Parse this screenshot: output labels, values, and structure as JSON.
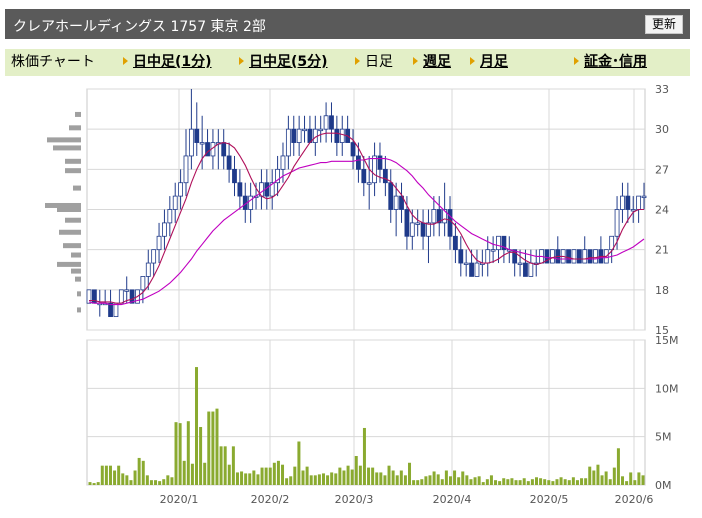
{
  "header": {
    "title": "クレアホールディングス  1757  東京 2部",
    "refresh_label": "更新"
  },
  "nav": {
    "label": "株価チャート",
    "items": [
      {
        "label": "日中足(1分)",
        "link": true
      },
      {
        "label": "日中足(5分)",
        "link": true
      },
      {
        "label": "日足",
        "link": false
      },
      {
        "label": "週足",
        "link": true
      },
      {
        "label": "月足",
        "link": true
      },
      {
        "label": "証金･信用",
        "link": true
      }
    ]
  },
  "chart_data": [
    {
      "type": "candlestick",
      "title": "",
      "ylim": [
        15,
        33
      ],
      "yticks": [
        "15",
        "18",
        "21",
        "24",
        "27",
        "30",
        "33"
      ],
      "xticks": [
        "2020/1",
        "2020/2",
        "2020/3",
        "2020/4",
        "2020/5",
        "2020/6"
      ],
      "grid": true,
      "colors": {
        "up": "#ffffff",
        "down": "#1f3a8a",
        "ma_short": "#b0105a",
        "ma_long": "#c000c0",
        "volume_profile": "#a0a0a0",
        "volume": "#8aaa30"
      },
      "candles": [
        [
          17,
          18,
          17,
          18
        ],
        [
          18,
          18,
          17,
          17
        ],
        [
          17,
          18,
          16,
          17
        ],
        [
          17,
          18,
          17,
          17
        ],
        [
          17,
          18,
          16,
          16
        ],
        [
          16,
          17,
          16,
          17
        ],
        [
          17,
          18,
          17,
          18
        ],
        [
          18,
          19,
          17,
          18
        ],
        [
          18,
          18,
          17,
          17
        ],
        [
          17,
          18,
          17,
          18
        ],
        [
          18,
          19,
          17,
          19
        ],
        [
          19,
          21,
          18,
          20
        ],
        [
          20,
          21,
          19,
          21
        ],
        [
          21,
          23,
          20,
          22
        ],
        [
          22,
          24,
          21,
          23
        ],
        [
          23,
          25,
          22,
          24
        ],
        [
          24,
          26,
          23,
          25
        ],
        [
          25,
          27,
          24,
          26
        ],
        [
          26,
          30,
          25,
          28
        ],
        [
          28,
          33,
          27,
          30
        ],
        [
          30,
          32,
          28,
          29
        ],
        [
          29,
          31,
          27,
          29
        ],
        [
          29,
          30,
          28,
          28
        ],
        [
          28,
          30,
          27,
          29
        ],
        [
          29,
          30,
          27,
          29
        ],
        [
          29,
          30,
          27,
          28
        ],
        [
          28,
          29,
          26,
          27
        ],
        [
          27,
          28,
          25,
          26
        ],
        [
          26,
          27,
          24,
          25
        ],
        [
          25,
          26,
          23,
          24
        ],
        [
          24,
          26,
          23,
          25
        ],
        [
          25,
          26,
          24,
          25
        ],
        [
          25,
          27,
          24,
          26
        ],
        [
          26,
          27,
          24,
          25
        ],
        [
          25,
          27,
          24,
          26
        ],
        [
          26,
          28,
          25,
          27
        ],
        [
          27,
          29,
          26,
          28
        ],
        [
          28,
          31,
          27,
          30
        ],
        [
          30,
          31,
          28,
          29
        ],
        [
          29,
          31,
          28,
          30
        ],
        [
          30,
          31,
          29,
          30
        ],
        [
          30,
          31,
          29,
          29
        ],
        [
          29,
          31,
          28,
          30
        ],
        [
          30,
          31,
          29,
          30
        ],
        [
          30,
          32,
          29,
          31
        ],
        [
          31,
          32,
          29,
          30
        ],
        [
          30,
          31,
          28,
          29
        ],
        [
          29,
          31,
          28,
          30
        ],
        [
          30,
          31,
          29,
          29
        ],
        [
          29,
          30,
          27,
          28
        ],
        [
          28,
          29,
          26,
          27
        ],
        [
          27,
          28,
          25,
          26
        ],
        [
          26,
          28,
          24,
          26
        ],
        [
          26,
          29,
          25,
          28
        ],
        [
          28,
          29,
          26,
          27
        ],
        [
          27,
          28,
          25,
          26
        ],
        [
          26,
          27,
          23,
          24
        ],
        [
          24,
          26,
          22,
          25
        ],
        [
          25,
          26,
          23,
          24
        ],
        [
          24,
          25,
          21,
          22
        ],
        [
          22,
          24,
          21,
          23
        ],
        [
          23,
          24,
          22,
          23
        ],
        [
          23,
          24,
          21,
          22
        ],
        [
          22,
          24,
          20,
          23
        ],
        [
          23,
          25,
          22,
          24
        ],
        [
          24,
          25,
          22,
          23
        ],
        [
          23,
          26,
          22,
          24
        ],
        [
          24,
          25,
          21,
          22
        ],
        [
          22,
          23,
          20,
          21
        ],
        [
          21,
          22,
          19,
          20
        ],
        [
          20,
          21,
          19,
          20
        ],
        [
          20,
          21,
          19,
          19
        ],
        [
          19,
          21,
          19,
          20
        ],
        [
          20,
          21,
          19,
          20
        ],
        [
          20,
          22,
          19,
          21
        ],
        [
          21,
          22,
          20,
          21
        ],
        [
          21,
          22,
          20,
          22
        ],
        [
          22,
          22,
          20,
          21
        ],
        [
          21,
          22,
          20,
          21
        ],
        [
          21,
          21,
          19,
          20
        ],
        [
          20,
          21,
          19,
          20
        ],
        [
          20,
          21,
          19,
          19
        ],
        [
          19,
          21,
          19,
          20
        ],
        [
          20,
          21,
          19,
          20
        ],
        [
          20,
          21,
          20,
          21
        ],
        [
          21,
          21,
          20,
          20
        ],
        [
          20,
          21,
          20,
          21
        ],
        [
          21,
          22,
          20,
          20
        ],
        [
          20,
          21,
          20,
          21
        ],
        [
          21,
          21,
          20,
          20
        ],
        [
          20,
          21,
          20,
          21
        ],
        [
          21,
          21,
          20,
          20
        ],
        [
          20,
          22,
          20,
          21
        ],
        [
          21,
          21,
          20,
          20
        ],
        [
          20,
          21,
          20,
          21
        ],
        [
          21,
          22,
          20,
          20
        ],
        [
          20,
          21,
          20,
          21
        ],
        [
          21,
          22,
          20,
          22
        ],
        [
          22,
          25,
          21,
          24
        ],
        [
          24,
          26,
          23,
          25
        ],
        [
          25,
          26,
          23,
          24
        ],
        [
          24,
          25,
          23,
          24
        ],
        [
          24,
          25,
          23,
          25
        ],
        [
          25,
          26,
          24,
          25
        ]
      ],
      "ma_short": [
        17.2,
        17.2,
        17.1,
        17.1,
        17.1,
        17,
        17,
        17.2,
        17.3,
        17.5,
        17.8,
        18.3,
        19,
        19.8,
        20.8,
        21.8,
        22.8,
        23.8,
        24.8,
        26,
        27,
        27.8,
        28.3,
        28.6,
        28.9,
        29,
        28.9,
        28.6,
        28,
        27.3,
        26.4,
        25.6,
        25,
        24.8,
        24.9,
        25.2,
        25.8,
        26.4,
        27.2,
        27.8,
        28.4,
        29,
        29.4,
        29.6,
        29.7,
        29.7,
        29.7,
        29.6,
        29.5,
        29.2,
        28.6,
        27.8,
        27,
        26.6,
        26.4,
        26.3,
        26.1,
        25.6,
        25.1,
        24.3,
        23.6,
        23.2,
        23,
        22.9,
        22.9,
        23.1,
        23.3,
        23.2,
        22.8,
        22.2,
        21.4,
        20.7,
        20.2,
        20,
        20,
        20.1,
        20.3,
        20.6,
        20.8,
        20.8,
        20.5,
        20.2,
        20,
        19.9,
        20,
        20.2,
        20.4,
        20.5,
        20.5,
        20.4,
        20.3,
        20.3,
        20.3,
        20.4,
        20.4,
        20.5,
        20.5,
        20.9,
        21.6,
        22.5,
        23.2,
        23.8,
        24,
        24
      ],
      "ma_long": [
        17.1,
        17,
        17,
        17,
        16.9,
        16.9,
        16.9,
        17,
        17.1,
        17.2,
        17.3,
        17.5,
        17.7,
        17.9,
        18.2,
        18.5,
        18.9,
        19.3,
        19.8,
        20.3,
        20.9,
        21.4,
        21.9,
        22.4,
        22.8,
        23.2,
        23.5,
        23.8,
        24.1,
        24.4,
        24.7,
        25,
        25.3,
        25.6,
        25.9,
        26.2,
        26.5,
        26.7,
        26.9,
        27.1,
        27.2,
        27.3,
        27.4,
        27.5,
        27.5,
        27.6,
        27.6,
        27.6,
        27.6,
        27.6,
        27.7,
        27.7,
        27.8,
        27.8,
        27.8,
        27.8,
        27.7,
        27.5,
        27.2,
        26.9,
        26.5,
        26,
        25.6,
        25.1,
        24.7,
        24.3,
        23.9,
        23.5,
        23.1,
        22.8,
        22.5,
        22.2,
        22,
        21.8,
        21.6,
        21.4,
        21.3,
        21.2,
        21,
        20.9,
        20.8,
        20.7,
        20.6,
        20.5,
        20.5,
        20.4,
        20.4,
        20.3,
        20.3,
        20.3,
        20.3,
        20.3,
        20.3,
        20.3,
        20.3,
        20.4,
        20.4,
        20.5,
        20.6,
        20.8,
        21,
        21.2,
        21.5,
        21.8
      ],
      "volume_profile": [
        {
          "price": 31.1,
          "volume": 3
        },
        {
          "price": 30.1,
          "volume": 6
        },
        {
          "price": 29.2,
          "volume": 17
        },
        {
          "price": 28.6,
          "volume": 14
        },
        {
          "price": 27.6,
          "volume": 8
        },
        {
          "price": 26.9,
          "volume": 8
        },
        {
          "price": 25.6,
          "volume": 4
        },
        {
          "price": 24.3,
          "volume": 18
        },
        {
          "price": 24.0,
          "volume": 12
        },
        {
          "price": 23.2,
          "volume": 8
        },
        {
          "price": 22.3,
          "volume": 11
        },
        {
          "price": 21.3,
          "volume": 9
        },
        {
          "price": 20.6,
          "volume": 5
        },
        {
          "price": 19.9,
          "volume": 12
        },
        {
          "price": 19.4,
          "volume": 5
        },
        {
          "price": 18.8,
          "volume": 3
        },
        {
          "price": 17.7,
          "volume": 2
        },
        {
          "price": 16.5,
          "volume": 2
        }
      ]
    },
    {
      "type": "bar",
      "title": "",
      "ylim": [
        0,
        15
      ],
      "yticks": [
        "0M",
        "5M",
        "10M",
        "15M"
      ],
      "xticks": [
        "2020/1",
        "2020/2",
        "2020/3",
        "2020/4",
        "2020/5",
        "2020/6"
      ],
      "values": [
        0.3,
        0.2,
        0.3,
        2,
        2,
        2,
        1.5,
        2,
        1.2,
        1,
        0.5,
        1.5,
        2.8,
        2.5,
        1,
        0.5,
        0.5,
        0.4,
        0.6,
        1,
        0.8,
        6.5,
        6.4,
        2.5,
        6.6,
        2.2,
        12.2,
        6,
        2.3,
        7.6,
        7.6,
        7.9,
        4,
        4,
        2.1,
        4,
        1.3,
        1.4,
        1.2,
        1.2,
        1.5,
        1.1,
        1.8,
        1.8,
        1.8,
        2.3,
        2.5,
        2.1,
        0.7,
        0.9,
        1.9,
        4.5,
        1.5,
        1.9,
        1,
        1,
        1.1,
        1.2,
        1,
        1.3,
        1.2,
        1.8,
        1.5,
        2,
        1.6,
        3,
        2,
        5.9,
        1.8,
        1.8,
        1.3,
        1.3,
        1,
        2,
        1.5,
        1,
        1.5,
        1,
        2.3,
        0.5,
        0.5,
        0.6,
        0.9,
        1,
        1.4,
        1.1,
        0.6,
        1.5,
        0.9,
        1.5,
        0.8,
        1.4,
        1,
        0.6,
        0.8,
        0.9,
        0.3,
        0.6,
        1,
        0.5,
        0.4,
        0.7,
        0.6,
        0.7,
        0.5,
        0.5,
        0.7,
        0.4,
        0.6,
        0.8,
        0.7,
        0.6,
        0.5,
        0.4,
        0.6,
        0.8,
        0.6,
        0.5,
        0.8,
        0.5,
        0.7,
        0.7,
        1.9,
        1.5,
        2.1,
        1,
        1.4,
        0.6,
        1.8,
        3.8,
        0.9,
        0.4,
        1.3,
        0.5,
        1.3,
        1
      ]
    }
  ]
}
